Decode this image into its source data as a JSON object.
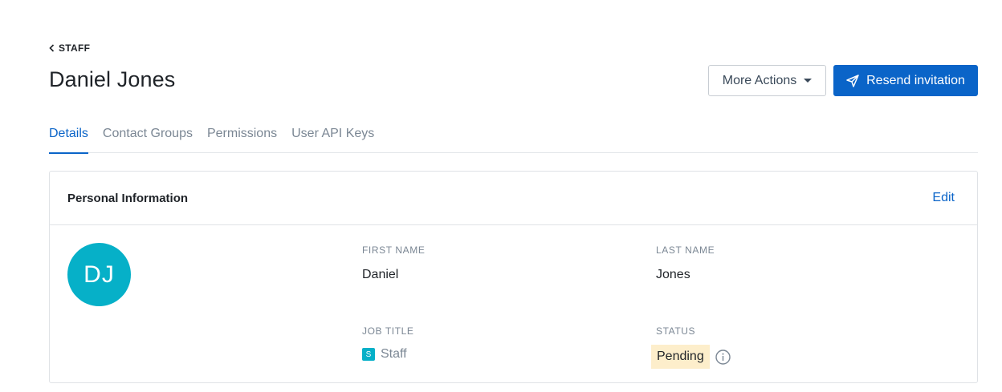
{
  "breadcrumb": {
    "label": "STAFF"
  },
  "page": {
    "title": "Daniel Jones"
  },
  "actions": {
    "more_actions_label": "More Actions",
    "resend_label": "Resend invitation"
  },
  "tabs": [
    {
      "label": "Details",
      "active": true
    },
    {
      "label": "Contact Groups",
      "active": false
    },
    {
      "label": "Permissions",
      "active": false
    },
    {
      "label": "User API Keys",
      "active": false
    }
  ],
  "card": {
    "title": "Personal Information",
    "edit_label": "Edit",
    "avatar_initials": "DJ",
    "first_name": {
      "label": "FIRST NAME",
      "value": "Daniel"
    },
    "last_name": {
      "label": "LAST NAME",
      "value": "Jones"
    },
    "job_title": {
      "label": "JOB TITLE",
      "badge": "S",
      "value": "Staff"
    },
    "status": {
      "label": "STATUS",
      "value": "Pending"
    }
  },
  "colors": {
    "primary": "#0a64c8",
    "avatar": "#06b0c8",
    "pending_bg": "#fdeecb"
  },
  "icons": [
    "chevron-left-icon",
    "caret-down-icon",
    "send-icon",
    "info-icon"
  ]
}
